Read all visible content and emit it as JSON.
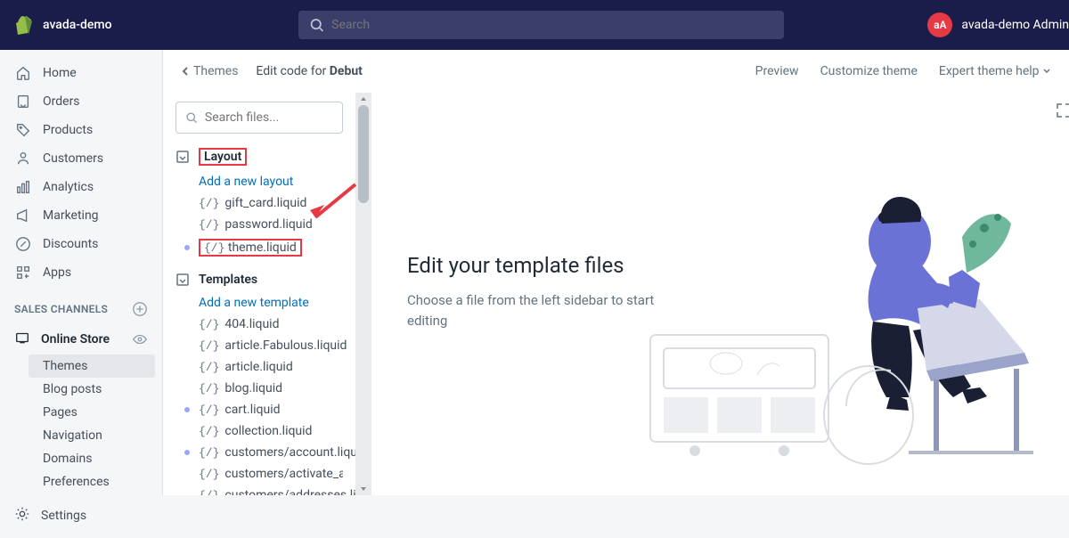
{
  "header": {
    "store_name": "avada-demo",
    "search_placeholder": "Search",
    "avatar_initials": "aA",
    "user_name": "avada-demo Admin"
  },
  "nav": {
    "home": "Home",
    "orders": "Orders",
    "products": "Products",
    "customers": "Customers",
    "analytics": "Analytics",
    "marketing": "Marketing",
    "discounts": "Discounts",
    "apps": "Apps",
    "sales_channels_label": "SALES CHANNELS",
    "online_store": "Online Store",
    "sub": {
      "themes": "Themes",
      "blog_posts": "Blog posts",
      "pages": "Pages",
      "navigation": "Navigation",
      "domains": "Domains",
      "preferences": "Preferences"
    },
    "settings": "Settings"
  },
  "crumb": {
    "back": "Themes",
    "title_prefix": "Edit code for ",
    "theme_name": "Debut",
    "preview": "Preview",
    "customize": "Customize theme",
    "expert": "Expert theme help"
  },
  "files": {
    "search_placeholder": "Search files...",
    "folders": {
      "layout": {
        "name": "Layout",
        "add": "Add a new layout",
        "items": [
          "gift_card.liquid",
          "password.liquid",
          "theme.liquid"
        ]
      },
      "templates": {
        "name": "Templates",
        "add": "Add a new template",
        "items": [
          "404.liquid",
          "article.Fabulous.liquid",
          "article.liquid",
          "blog.liquid",
          "cart.liquid",
          "collection.liquid",
          "customers/account.liquid",
          "customers/activate_account.liquid",
          "customers/addresses.liquid"
        ]
      }
    },
    "code_prefix": "{/}"
  },
  "preview": {
    "title": "Edit your template files",
    "subtitle": "Choose a file from the left sidebar to start editing"
  }
}
